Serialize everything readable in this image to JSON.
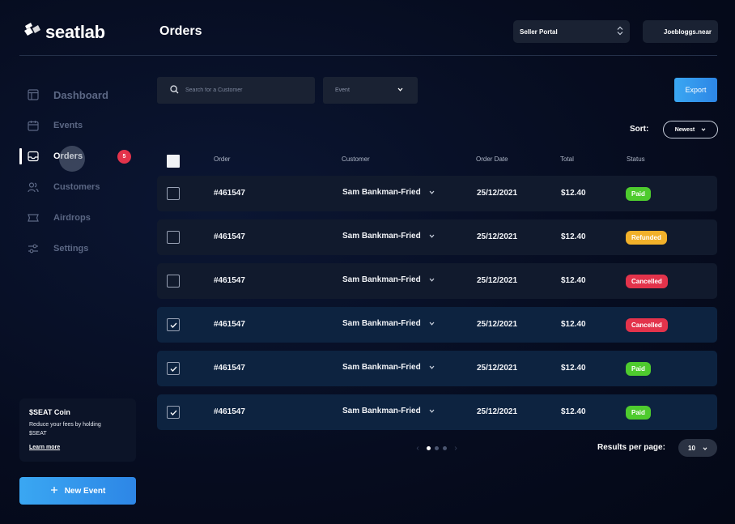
{
  "brand": {
    "name": "seatlab"
  },
  "header": {
    "title": "Orders",
    "portal_select": "Seller Portal",
    "username": "Joebloggs.near"
  },
  "sidebar": {
    "items": [
      {
        "label": "Dashboard",
        "icon": "dashboard-icon"
      },
      {
        "label": "Events",
        "icon": "calendar-icon"
      },
      {
        "label": "Orders",
        "icon": "inbox-icon",
        "badge": "5",
        "active": true
      },
      {
        "label": "Customers",
        "icon": "users-icon"
      },
      {
        "label": "Airdrops",
        "icon": "ticket-icon"
      },
      {
        "label": "Settings",
        "icon": "sliders-icon"
      }
    ],
    "coin": {
      "title": "$SEAT Coin",
      "description": "Reduce your fees by holding $SEAT",
      "link": "Learn more"
    },
    "new_event_label": "New Event"
  },
  "toolbar": {
    "search_placeholder": "Search for a Customer",
    "event_filter": "Event",
    "export_label": "Export",
    "sort_label": "Sort:",
    "sort_value": "Newest"
  },
  "table": {
    "columns": [
      "Order",
      "Customer",
      "Order Date",
      "Total",
      "Status"
    ],
    "rows": [
      {
        "order": "#461547",
        "customer": "Sam Bankman-Fried",
        "date": "25/12/2021",
        "total": "$12.40",
        "status": "Paid",
        "checked": false
      },
      {
        "order": "#461547",
        "customer": "Sam Bankman-Fried",
        "date": "25/12/2021",
        "total": "$12.40",
        "status": "Refunded",
        "checked": false
      },
      {
        "order": "#461547",
        "customer": "Sam Bankman-Fried",
        "date": "25/12/2021",
        "total": "$12.40",
        "status": "Cancelled",
        "checked": false
      },
      {
        "order": "#461547",
        "customer": "Sam Bankman-Fried",
        "date": "25/12/2021",
        "total": "$12.40",
        "status": "Cancelled",
        "checked": true
      },
      {
        "order": "#461547",
        "customer": "Sam Bankman-Fried",
        "date": "25/12/2021",
        "total": "$12.40",
        "status": "Paid",
        "checked": true
      },
      {
        "order": "#461547",
        "customer": "Sam Bankman-Fried",
        "date": "25/12/2021",
        "total": "$12.40",
        "status": "Paid",
        "checked": true
      }
    ]
  },
  "pagination": {
    "current_page": 1,
    "page_count": 3,
    "results_label": "Results per page:",
    "results_value": "10"
  },
  "colors": {
    "accent": "#2d86e6",
    "paid": "#4ecb2e",
    "refunded": "#f2b12a",
    "cancelled": "#e3334b",
    "badge": "#e3334b"
  }
}
